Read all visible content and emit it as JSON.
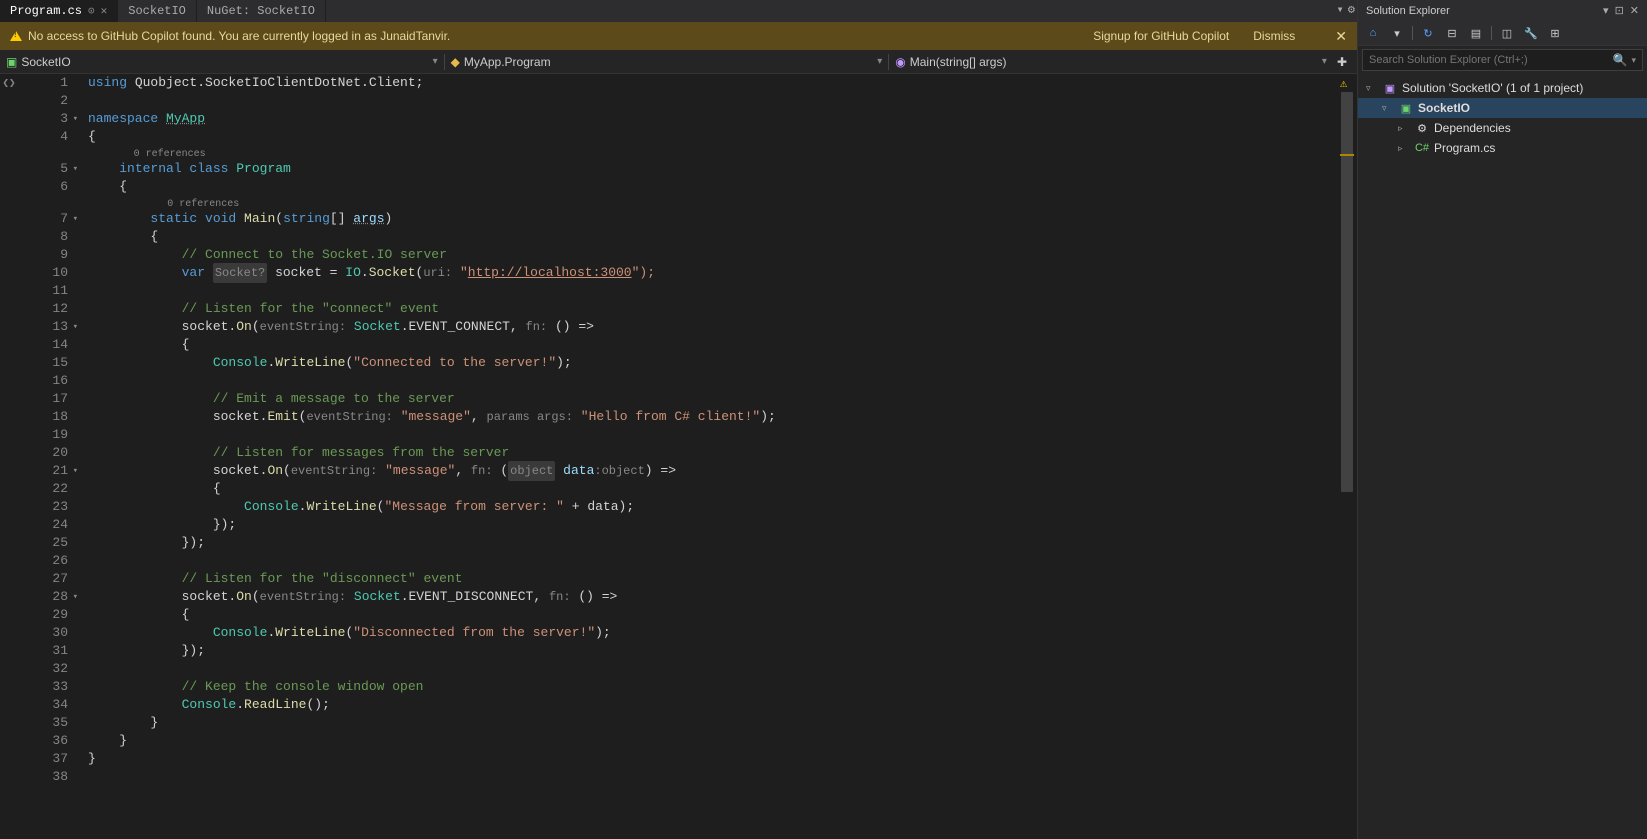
{
  "tabs": {
    "items": [
      {
        "label": "Program.cs",
        "active": true,
        "closeable": true
      },
      {
        "label": "SocketIO",
        "active": false,
        "closeable": false
      },
      {
        "label": "NuGet: SocketIO",
        "active": false,
        "closeable": false
      }
    ]
  },
  "copilot_warning": {
    "message": "No access to GitHub Copilot found. You are currently logged in as JunaidTanvir.",
    "signup": "Signup for GitHub Copilot",
    "dismiss": "Dismiss"
  },
  "breadcrumb": {
    "project": "SocketIO",
    "class": "MyApp.Program",
    "method": "Main(string[] args)"
  },
  "code": {
    "ref0": "0 references",
    "lines": [
      {
        "n": 1,
        "seg": [
          {
            "t": "using ",
            "c": "kw"
          },
          {
            "t": "Quobject.SocketIoClientDotNet.Client;",
            "c": "ns"
          }
        ]
      },
      {
        "n": 2,
        "seg": []
      },
      {
        "n": 3,
        "fold": true,
        "seg": [
          {
            "t": "namespace ",
            "c": "kw"
          },
          {
            "t": "MyApp",
            "c": "cls underline"
          }
        ]
      },
      {
        "n": 4,
        "seg": [
          {
            "t": "{",
            "c": "op"
          }
        ]
      },
      {
        "ref": true,
        "indent": 4
      },
      {
        "n": 5,
        "fold": true,
        "seg": [
          {
            "t": "    ",
            "c": ""
          },
          {
            "t": "internal class ",
            "c": "kw"
          },
          {
            "t": "Program",
            "c": "cls"
          }
        ]
      },
      {
        "n": 6,
        "seg": [
          {
            "t": "    {",
            "c": "op"
          }
        ]
      },
      {
        "ref": true,
        "indent": 8
      },
      {
        "n": 7,
        "fold": true,
        "seg": [
          {
            "t": "        ",
            "c": ""
          },
          {
            "t": "static void ",
            "c": "kw"
          },
          {
            "t": "Main",
            "c": "mth"
          },
          {
            "t": "(",
            "c": "op"
          },
          {
            "t": "string",
            "c": "kw"
          },
          {
            "t": "[] ",
            "c": "op"
          },
          {
            "t": "args",
            "c": "prm underline"
          },
          {
            "t": ")",
            "c": "op"
          }
        ]
      },
      {
        "n": 8,
        "seg": [
          {
            "t": "        {",
            "c": "op"
          }
        ]
      },
      {
        "n": 9,
        "seg": [
          {
            "t": "            ",
            "c": ""
          },
          {
            "t": "// Connect to the Socket.IO server",
            "c": "cmt"
          }
        ]
      },
      {
        "n": 10,
        "seg": [
          {
            "t": "            ",
            "c": ""
          },
          {
            "t": "var ",
            "c": "kw"
          },
          {
            "t": "Socket?",
            "c": "cls hint tag-bg"
          },
          {
            "t": " socket = ",
            "c": "op"
          },
          {
            "t": "IO",
            "c": "cls"
          },
          {
            "t": ".",
            "c": "op"
          },
          {
            "t": "Socket",
            "c": "mth"
          },
          {
            "t": "(",
            "c": "op"
          },
          {
            "t": "uri:",
            "c": "hint"
          },
          {
            "t": " ",
            "c": ""
          },
          {
            "t": "\"",
            "c": "str"
          },
          {
            "t": "http://localhost:3000",
            "c": "url"
          },
          {
            "t": "\");",
            "c": "str"
          }
        ]
      },
      {
        "n": 11,
        "seg": []
      },
      {
        "n": 12,
        "seg": [
          {
            "t": "            ",
            "c": ""
          },
          {
            "t": "// Listen for the \"connect\" event",
            "c": "cmt"
          }
        ]
      },
      {
        "n": 13,
        "fold": true,
        "seg": [
          {
            "t": "            socket.",
            "c": "op"
          },
          {
            "t": "On",
            "c": "mth"
          },
          {
            "t": "(",
            "c": "op"
          },
          {
            "t": "eventString:",
            "c": "hint"
          },
          {
            "t": " ",
            "c": ""
          },
          {
            "t": "Socket",
            "c": "cls"
          },
          {
            "t": ".EVENT_CONNECT, ",
            "c": "op"
          },
          {
            "t": "fn:",
            "c": "hint"
          },
          {
            "t": " () =>",
            "c": "op"
          }
        ]
      },
      {
        "n": 14,
        "seg": [
          {
            "t": "            {",
            "c": "op"
          }
        ]
      },
      {
        "n": 15,
        "seg": [
          {
            "t": "                ",
            "c": ""
          },
          {
            "t": "Console",
            "c": "cls"
          },
          {
            "t": ".",
            "c": "op"
          },
          {
            "t": "WriteLine",
            "c": "mth"
          },
          {
            "t": "(",
            "c": "op"
          },
          {
            "t": "\"Connected to the server!\"",
            "c": "str"
          },
          {
            "t": ");",
            "c": "op"
          }
        ]
      },
      {
        "n": 16,
        "seg": []
      },
      {
        "n": 17,
        "seg": [
          {
            "t": "                ",
            "c": ""
          },
          {
            "t": "// Emit a message to the server",
            "c": "cmt"
          }
        ]
      },
      {
        "n": 18,
        "seg": [
          {
            "t": "                socket.",
            "c": "op"
          },
          {
            "t": "Emit",
            "c": "mth"
          },
          {
            "t": "(",
            "c": "op"
          },
          {
            "t": "eventString:",
            "c": "hint"
          },
          {
            "t": " ",
            "c": ""
          },
          {
            "t": "\"message\"",
            "c": "str"
          },
          {
            "t": ", ",
            "c": "op"
          },
          {
            "t": "params args:",
            "c": "hint"
          },
          {
            "t": " ",
            "c": ""
          },
          {
            "t": "\"Hello from C# client!\"",
            "c": "str"
          },
          {
            "t": ");",
            "c": "op"
          }
        ]
      },
      {
        "n": 19,
        "seg": []
      },
      {
        "n": 20,
        "seg": [
          {
            "t": "                ",
            "c": ""
          },
          {
            "t": "// Listen for messages from the server",
            "c": "cmt"
          }
        ]
      },
      {
        "n": 21,
        "fold": true,
        "seg": [
          {
            "t": "                socket.",
            "c": "op"
          },
          {
            "t": "On",
            "c": "mth"
          },
          {
            "t": "(",
            "c": "op"
          },
          {
            "t": "eventString:",
            "c": "hint"
          },
          {
            "t": " ",
            "c": ""
          },
          {
            "t": "\"message\"",
            "c": "str"
          },
          {
            "t": ", ",
            "c": "op"
          },
          {
            "t": "fn:",
            "c": "hint"
          },
          {
            "t": " (",
            "c": "op"
          },
          {
            "t": "object",
            "c": "kw hint tag-bg"
          },
          {
            "t": " data",
            "c": "prm"
          },
          {
            "t": ":object",
            "c": "hint"
          },
          {
            "t": ") =>",
            "c": "op"
          }
        ]
      },
      {
        "n": 22,
        "seg": [
          {
            "t": "                {",
            "c": "op"
          }
        ]
      },
      {
        "n": 23,
        "seg": [
          {
            "t": "                    ",
            "c": ""
          },
          {
            "t": "Console",
            "c": "cls"
          },
          {
            "t": ".",
            "c": "op"
          },
          {
            "t": "WriteLine",
            "c": "mth"
          },
          {
            "t": "(",
            "c": "op"
          },
          {
            "t": "\"Message from server: \"",
            "c": "str"
          },
          {
            "t": " + data);",
            "c": "op"
          }
        ]
      },
      {
        "n": 24,
        "seg": [
          {
            "t": "                });",
            "c": "op"
          }
        ]
      },
      {
        "n": 25,
        "seg": [
          {
            "t": "            });",
            "c": "op"
          }
        ]
      },
      {
        "n": 26,
        "seg": []
      },
      {
        "n": 27,
        "seg": [
          {
            "t": "            ",
            "c": ""
          },
          {
            "t": "// Listen for the \"disconnect\" event",
            "c": "cmt"
          }
        ]
      },
      {
        "n": 28,
        "fold": true,
        "seg": [
          {
            "t": "            socket.",
            "c": "op"
          },
          {
            "t": "On",
            "c": "mth"
          },
          {
            "t": "(",
            "c": "op"
          },
          {
            "t": "eventString:",
            "c": "hint"
          },
          {
            "t": " ",
            "c": ""
          },
          {
            "t": "Socket",
            "c": "cls"
          },
          {
            "t": ".EVENT_DISCONNECT, ",
            "c": "op"
          },
          {
            "t": "fn:",
            "c": "hint"
          },
          {
            "t": " () =>",
            "c": "op"
          }
        ]
      },
      {
        "n": 29,
        "seg": [
          {
            "t": "            {",
            "c": "op"
          }
        ]
      },
      {
        "n": 30,
        "seg": [
          {
            "t": "                ",
            "c": ""
          },
          {
            "t": "Console",
            "c": "cls"
          },
          {
            "t": ".",
            "c": "op"
          },
          {
            "t": "WriteLine",
            "c": "mth"
          },
          {
            "t": "(",
            "c": "op"
          },
          {
            "t": "\"Disconnected from the server!\"",
            "c": "str"
          },
          {
            "t": ");",
            "c": "op"
          }
        ]
      },
      {
        "n": 31,
        "seg": [
          {
            "t": "            });",
            "c": "op"
          }
        ]
      },
      {
        "n": 32,
        "seg": []
      },
      {
        "n": 33,
        "seg": [
          {
            "t": "            ",
            "c": ""
          },
          {
            "t": "// Keep the console window open",
            "c": "cmt"
          }
        ]
      },
      {
        "n": 34,
        "seg": [
          {
            "t": "            ",
            "c": ""
          },
          {
            "t": "Console",
            "c": "cls"
          },
          {
            "t": ".",
            "c": "op"
          },
          {
            "t": "ReadLine",
            "c": "mth"
          },
          {
            "t": "();",
            "c": "op"
          }
        ]
      },
      {
        "n": 35,
        "seg": [
          {
            "t": "        }",
            "c": "op"
          }
        ]
      },
      {
        "n": 36,
        "seg": [
          {
            "t": "    }",
            "c": "op"
          }
        ]
      },
      {
        "n": 37,
        "seg": [
          {
            "t": "}",
            "c": "op"
          }
        ]
      },
      {
        "n": 38,
        "seg": []
      }
    ]
  },
  "solution_explorer": {
    "title": "Solution Explorer",
    "search_placeholder": "Search Solution Explorer (Ctrl+;)",
    "tree": [
      {
        "level": 0,
        "exp": "▿",
        "icon": "sln",
        "label": "Solution 'SocketIO' (1 of 1 project)"
      },
      {
        "level": 1,
        "exp": "▿",
        "icon": "csproj",
        "label": "SocketIO",
        "selected": true
      },
      {
        "level": 2,
        "exp": "▹",
        "icon": "dep",
        "label": "Dependencies"
      },
      {
        "level": 2,
        "exp": "▹",
        "icon": "cs",
        "label": "Program.cs"
      }
    ]
  }
}
